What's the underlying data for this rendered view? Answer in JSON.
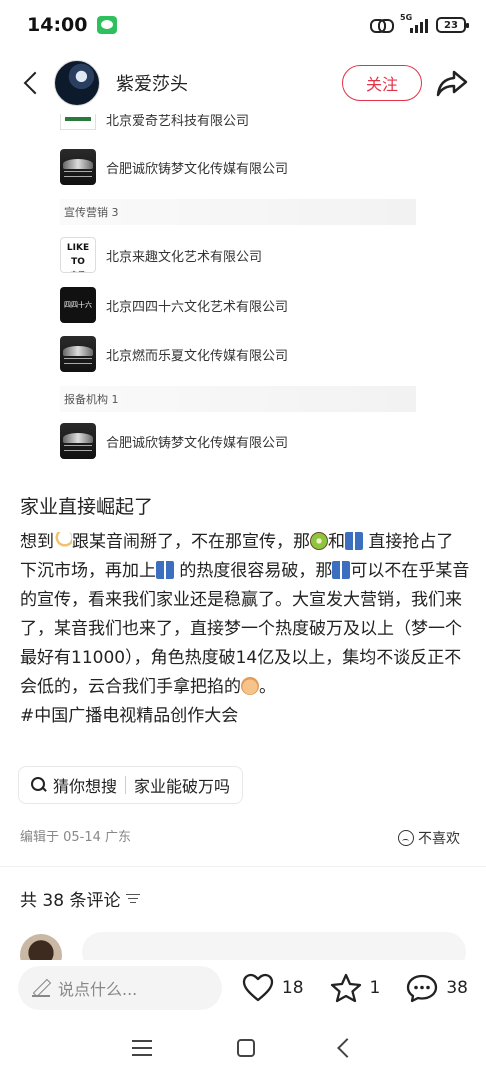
{
  "status_bar": {
    "time": "14:00",
    "network": "5G",
    "battery": "23"
  },
  "header": {
    "username": "紫爱莎头",
    "follow_label": "关注"
  },
  "companies": {
    "partial_name": "北京爱奇艺科技有限公司",
    "top_item": {
      "name": "合肥诚欣铸梦文化传媒有限公司",
      "logo": "car-logo"
    },
    "publicity_label": "宣传营销  3",
    "publicity_items": [
      {
        "name": "北京来趣文化艺术有限公司",
        "logo": "likedo-logo",
        "logo_text": "LIKE TO",
        "logo_sub": "来趣"
      },
      {
        "name": "北京四四十六文化艺术有限公司",
        "logo": "sisi-logo",
        "logo_text": "四四十六"
      },
      {
        "name": "北京燃而乐夏文化传媒有限公司",
        "logo": "car-logo"
      }
    ],
    "filing_label": "报备机构  1",
    "filing_items": [
      {
        "name": "合肥诚欣铸梦文化传媒有限公司",
        "logo": "car-logo"
      }
    ]
  },
  "post": {
    "title": "家业直接崛起了",
    "body_1": "想到",
    "body_2": "跟某音闹掰了，不在那宣传，那",
    "body_3": "和",
    "body_4": "直接抢占了下沉市场，再加上",
    "body_5": "的热度很容易破，那",
    "body_6": "可以不在乎某音的宣传，看来我们家业还是稳赢了。大宣发大营销，我们来了，某音我们也来了，直接梦一个热度破万及以上（梦一个最好有11000），角色热度破14亿及以上，集均不谈反正不会低的，云合我们手拿把掐的",
    "body_7": "。",
    "hashtag": "#中国广播电视精品创作大会"
  },
  "search_chip": {
    "label": "猜你想搜",
    "query": "家业能破万吗"
  },
  "meta": {
    "edited": "编辑于 05-14 广东",
    "dislike": "不喜欢"
  },
  "comments": {
    "count_label": "共 38 条评论"
  },
  "bottom_bar": {
    "placeholder": "说点什么...",
    "likes": "18",
    "favorites": "1",
    "comments": "38"
  },
  "colors": {
    "accent": "#e3324a"
  }
}
